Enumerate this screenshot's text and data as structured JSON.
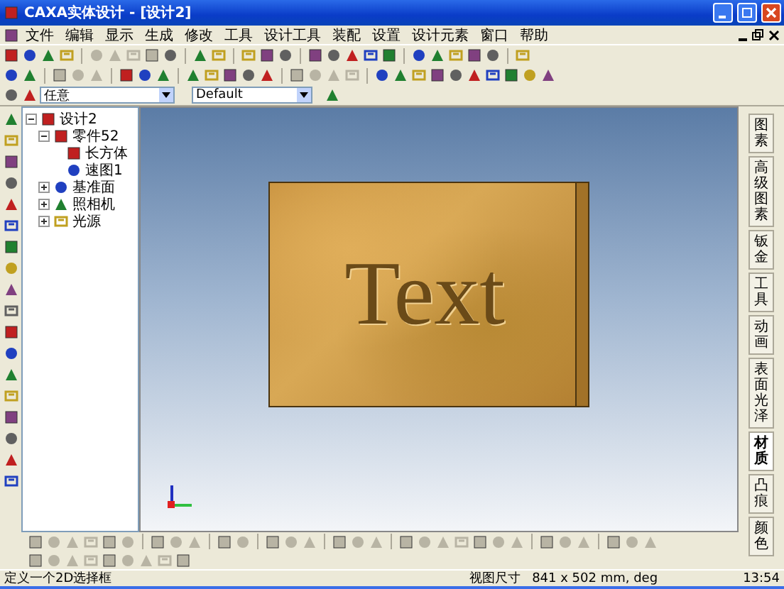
{
  "window": {
    "title": "CAXA实体设计 - [设计2]"
  },
  "menu": [
    "文件",
    "编辑",
    "显示",
    "生成",
    "修改",
    "工具",
    "设计工具",
    "装配",
    "设置",
    "设计元素",
    "窗口",
    "帮助"
  ],
  "selectors": [
    {
      "value": "任意"
    },
    {
      "value": "Default"
    }
  ],
  "tree": [
    {
      "label": "设计2",
      "expanded": true,
      "children": [
        {
          "label": "零件52",
          "expanded": true,
          "children": [
            {
              "label": "长方体"
            },
            {
              "label": "速图1"
            }
          ]
        },
        {
          "label": "基准面",
          "expanded": false
        },
        {
          "label": "照相机",
          "expanded": false
        },
        {
          "label": "光源",
          "expanded": false
        }
      ]
    }
  ],
  "model": {
    "text": "Text"
  },
  "side_tabs": [
    {
      "label": "图素",
      "selected": false
    },
    {
      "label": "高级图素",
      "selected": false
    },
    {
      "label": "钣金",
      "selected": false
    },
    {
      "label": "工具",
      "selected": false
    },
    {
      "label": "动画",
      "selected": false
    },
    {
      "label": "表面光泽",
      "selected": false
    },
    {
      "label": "材质",
      "selected": true
    },
    {
      "label": "凸痕",
      "selected": false
    },
    {
      "label": "颜色",
      "selected": false
    }
  ],
  "status_bar": {
    "message": "定义一个2D选择框",
    "view_size_label": "视图尺寸",
    "view_size": "841 x 502 mm, deg",
    "time": "13:54"
  }
}
